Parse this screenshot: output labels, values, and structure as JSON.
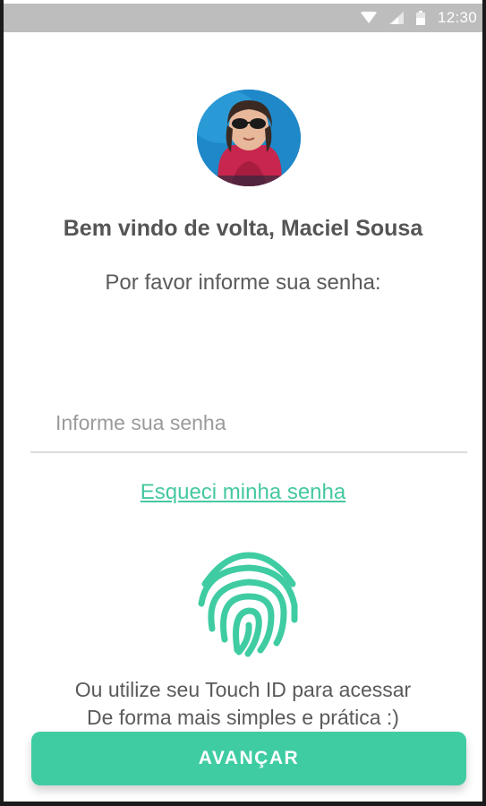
{
  "status_bar": {
    "time": "12:30",
    "icons": [
      "wifi-icon",
      "signal-icon",
      "battery-icon"
    ]
  },
  "profile": {
    "avatar": "user-avatar-photo"
  },
  "welcome": {
    "title": "Bem vindo de volta, Maciel Sousa",
    "prompt": "Por favor informe sua senha:"
  },
  "password": {
    "value": "",
    "placeholder": "Informe sua senha"
  },
  "forgot_password": {
    "label": "Esqueci minha senha"
  },
  "touch_id": {
    "icon": "fingerprint-icon",
    "line1": "Ou utilize seu Touch ID para acessar",
    "line2": "De forma mais simples e prática :)"
  },
  "actions": {
    "advance_label": "AVANÇAR"
  },
  "colors": {
    "accent": "#3fcca3",
    "link": "#45c8a2",
    "status_bar": "#bdbdbd"
  }
}
